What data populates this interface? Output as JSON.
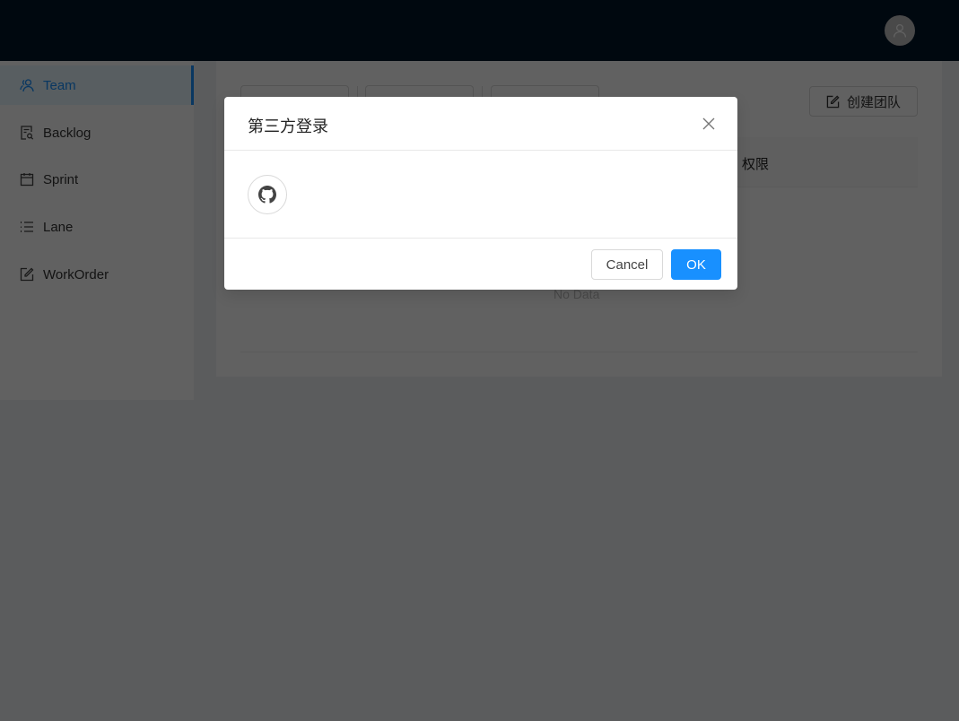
{
  "header": {
    "avatar_icon": "user-icon"
  },
  "sidebar": {
    "items": [
      {
        "label": "Team",
        "icon": "team-icon",
        "active": true
      },
      {
        "label": "Backlog",
        "icon": "file-search-icon",
        "active": false
      },
      {
        "label": "Sprint",
        "icon": "calendar-icon",
        "active": false
      },
      {
        "label": "Lane",
        "icon": "ordered-list-icon",
        "active": false
      },
      {
        "label": "WorkOrder",
        "icon": "edit-icon",
        "active": false
      }
    ]
  },
  "main": {
    "create_team_label": "创建团队",
    "table": {
      "columns": [
        "权限"
      ],
      "empty_text": "No Data"
    }
  },
  "modal": {
    "title": "第三方登录",
    "providers": [
      {
        "name": "github",
        "icon": "github-icon"
      }
    ],
    "cancel_label": "Cancel",
    "ok_label": "OK",
    "primary_color": "#1890ff"
  }
}
